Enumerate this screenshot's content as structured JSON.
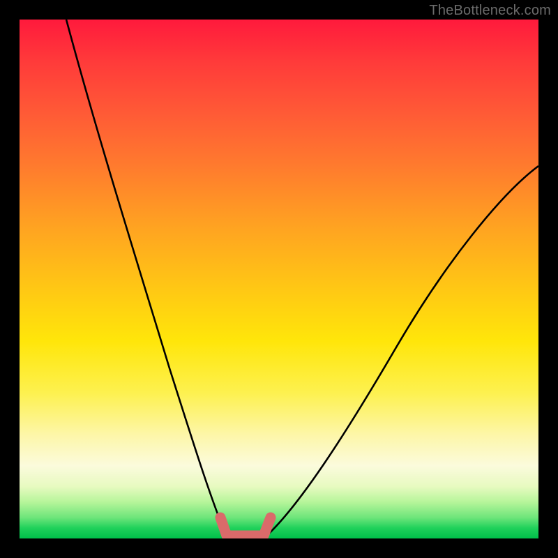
{
  "watermark": "TheBottleneck.com",
  "chart_data": {
    "type": "line",
    "title": "",
    "xlabel": "",
    "ylabel": "",
    "xlim": [
      0,
      100
    ],
    "ylim": [
      0,
      100
    ],
    "grid": false,
    "legend": false,
    "series": [
      {
        "name": "left-curve",
        "x": [
          9,
          12,
          15,
          18,
          21,
          24,
          27,
          30,
          33,
          35,
          37,
          39,
          40
        ],
        "values": [
          100,
          90,
          79,
          68,
          57,
          46,
          36,
          26,
          17,
          11,
          6,
          2,
          0
        ]
      },
      {
        "name": "right-curve",
        "x": [
          47,
          50,
          54,
          58,
          63,
          68,
          74,
          80,
          86,
          93,
          100
        ],
        "values": [
          0,
          2,
          6,
          11,
          17,
          24,
          32,
          40,
          48,
          56,
          63
        ]
      },
      {
        "name": "floor-band",
        "x": [
          39,
          40,
          41,
          42,
          43,
          44,
          45,
          46,
          47,
          48
        ],
        "values": [
          2,
          0,
          0,
          0,
          0,
          0,
          0,
          0,
          0,
          2
        ]
      }
    ],
    "colors": {
      "curve": "#000000",
      "floor": "#da6a6a",
      "gradient_top": "#ff1a3c",
      "gradient_bottom": "#00c04a"
    }
  }
}
